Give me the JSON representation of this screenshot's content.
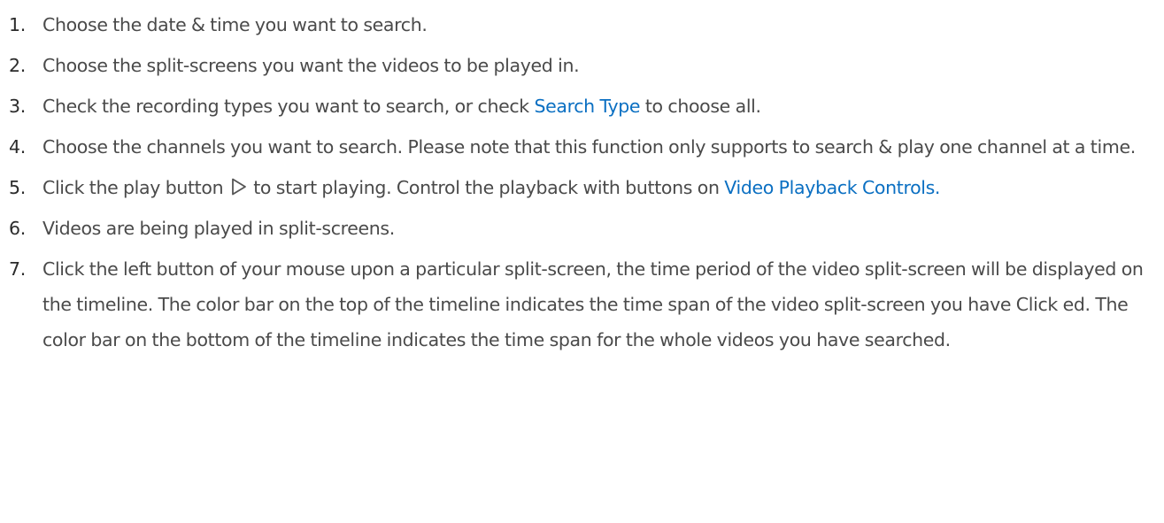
{
  "steps": [
    {
      "number": "1.",
      "text": "Choose the date & time you want to search."
    },
    {
      "number": "2.",
      "text": "Choose the split-screens you want the videos to be played in."
    },
    {
      "number": "3.",
      "before": "Check the recording types you want to search, or check ",
      "link": "Search Type",
      "after": " to choose all."
    },
    {
      "number": "4.",
      "text": "Choose the channels you want to search. Please note that this function only supports to search & play one channel at a time."
    },
    {
      "number": "5.",
      "before": "Click the play button",
      "icon": "play-icon",
      "middle": "to start playing. Control the playback with buttons on ",
      "link": "Video Playback Controls."
    },
    {
      "number": "6.",
      "text": "Videos are being played in split-screens."
    },
    {
      "number": "7.",
      "text": "Click the left button of your mouse upon a particular split-screen, the time period of the video split-screen will be displayed on the timeline. The color bar on the top of the timeline indicates the time span of the video split-screen you have Click ed. The color bar on the bottom of the timeline indicates the time span for the whole videos you have searched."
    }
  ],
  "colors": {
    "text": "#4a4a4a",
    "number": "#2b2b2b",
    "link": "#0a6fc2"
  }
}
